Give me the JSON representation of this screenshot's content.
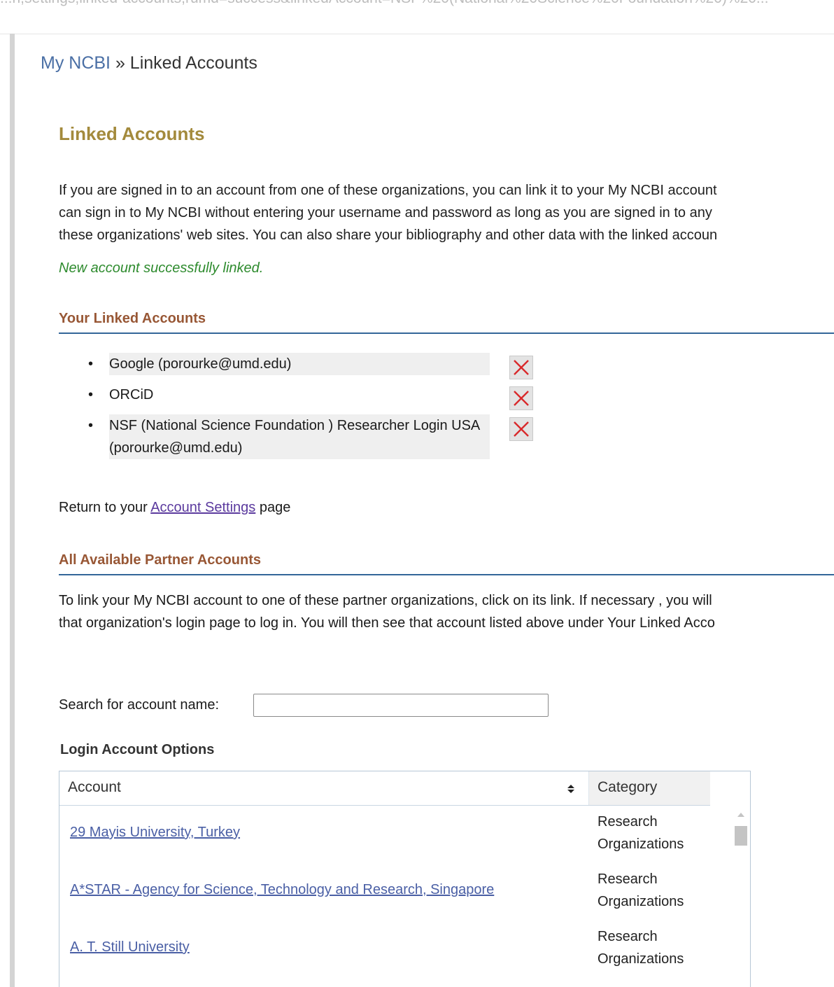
{
  "browser": {
    "url_fragment": "...n,settings,linked-accounts,rumd=success&linkedAccount=NSF%20(National%20Science%20Foundation%20)%20..."
  },
  "breadcrumb": {
    "root": "My NCBI",
    "separator": " » ",
    "current": "Linked Accounts"
  },
  "page": {
    "title": "Linked Accounts",
    "intro_lines": [
      "If you are signed in to an account from one of these organizations, you can link it to your My NCBI account",
      "can sign in to My NCBI without entering your username and password as long as you are signed in to any",
      "these organizations' web sites. You can also share your bibliography and other data with the linked accoun"
    ],
    "success_message": "New account successfully linked."
  },
  "linked_accounts": {
    "heading": "Your Linked Accounts",
    "items": [
      {
        "label": "Google (porourke@umd.edu)"
      },
      {
        "label": "ORCiD"
      },
      {
        "label": "NSF (National Science Foundation ) Researcher Login USA (porourke@umd.edu)"
      }
    ],
    "delete_icon": "red-x-icon",
    "delete_color": "#d9292b"
  },
  "return_line": {
    "prefix": "Return to your ",
    "link": "Account Settings",
    "suffix": " page"
  },
  "partners": {
    "heading": "All Available Partner Accounts",
    "text_lines": [
      "To link your My NCBI account to one of these partner organizations, click on its link. If necessary , you will",
      "that organization's login page to log in. You will then see that account listed above under Your Linked Acco"
    ],
    "search_label": "Search for account name:",
    "search_value": "",
    "options_title": "Login Account Options",
    "table": {
      "columns": [
        "Account",
        "Category"
      ],
      "rows": [
        {
          "account": "29 Mayis University, Turkey",
          "category": "Research Organizations"
        },
        {
          "account": "A*STAR - Agency for Science, Technology and Research, Singapore",
          "category": "Research Organizations"
        },
        {
          "account": "A. T. Still University",
          "category": "Research Organizations"
        }
      ]
    }
  },
  "colors": {
    "title": "#a38a3c",
    "section_heading": "#985735",
    "section_rule": "#336699",
    "success": "#2e8b2e",
    "link": "#4a5fa5",
    "visited_link": "#5b3a9e"
  }
}
